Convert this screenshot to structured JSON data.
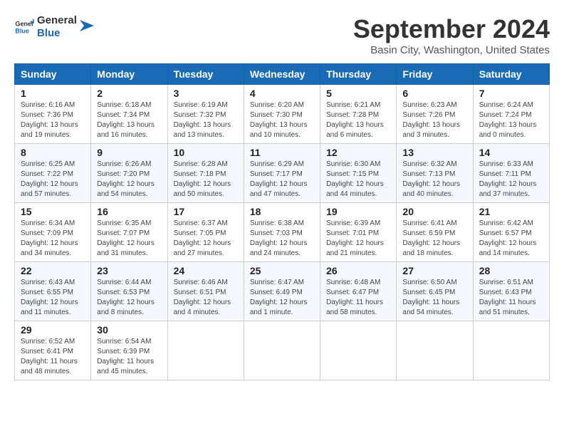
{
  "logo": {
    "line1": "General",
    "line2": "Blue"
  },
  "title": "September 2024",
  "location": "Basin City, Washington, United States",
  "weekdays": [
    "Sunday",
    "Monday",
    "Tuesday",
    "Wednesday",
    "Thursday",
    "Friday",
    "Saturday"
  ],
  "weeks": [
    [
      {
        "day": 1,
        "sunrise": "6:16 AM",
        "sunset": "7:36 PM",
        "daylight": "13 hours and 19 minutes."
      },
      {
        "day": 2,
        "sunrise": "6:18 AM",
        "sunset": "7:34 PM",
        "daylight": "13 hours and 16 minutes."
      },
      {
        "day": 3,
        "sunrise": "6:19 AM",
        "sunset": "7:32 PM",
        "daylight": "13 hours and 13 minutes."
      },
      {
        "day": 4,
        "sunrise": "6:20 AM",
        "sunset": "7:30 PM",
        "daylight": "13 hours and 10 minutes."
      },
      {
        "day": 5,
        "sunrise": "6:21 AM",
        "sunset": "7:28 PM",
        "daylight": "13 hours and 6 minutes."
      },
      {
        "day": 6,
        "sunrise": "6:23 AM",
        "sunset": "7:26 PM",
        "daylight": "13 hours and 3 minutes."
      },
      {
        "day": 7,
        "sunrise": "6:24 AM",
        "sunset": "7:24 PM",
        "daylight": "13 hours and 0 minutes."
      }
    ],
    [
      {
        "day": 8,
        "sunrise": "6:25 AM",
        "sunset": "7:22 PM",
        "daylight": "12 hours and 57 minutes."
      },
      {
        "day": 9,
        "sunrise": "6:26 AM",
        "sunset": "7:20 PM",
        "daylight": "12 hours and 54 minutes."
      },
      {
        "day": 10,
        "sunrise": "6:28 AM",
        "sunset": "7:18 PM",
        "daylight": "12 hours and 50 minutes."
      },
      {
        "day": 11,
        "sunrise": "6:29 AM",
        "sunset": "7:17 PM",
        "daylight": "12 hours and 47 minutes."
      },
      {
        "day": 12,
        "sunrise": "6:30 AM",
        "sunset": "7:15 PM",
        "daylight": "12 hours and 44 minutes."
      },
      {
        "day": 13,
        "sunrise": "6:32 AM",
        "sunset": "7:13 PM",
        "daylight": "12 hours and 40 minutes."
      },
      {
        "day": 14,
        "sunrise": "6:33 AM",
        "sunset": "7:11 PM",
        "daylight": "12 hours and 37 minutes."
      }
    ],
    [
      {
        "day": 15,
        "sunrise": "6:34 AM",
        "sunset": "7:09 PM",
        "daylight": "12 hours and 34 minutes."
      },
      {
        "day": 16,
        "sunrise": "6:35 AM",
        "sunset": "7:07 PM",
        "daylight": "12 hours and 31 minutes."
      },
      {
        "day": 17,
        "sunrise": "6:37 AM",
        "sunset": "7:05 PM",
        "daylight": "12 hours and 27 minutes."
      },
      {
        "day": 18,
        "sunrise": "6:38 AM",
        "sunset": "7:03 PM",
        "daylight": "12 hours and 24 minutes."
      },
      {
        "day": 19,
        "sunrise": "6:39 AM",
        "sunset": "7:01 PM",
        "daylight": "12 hours and 21 minutes."
      },
      {
        "day": 20,
        "sunrise": "6:41 AM",
        "sunset": "6:59 PM",
        "daylight": "12 hours and 18 minutes."
      },
      {
        "day": 21,
        "sunrise": "6:42 AM",
        "sunset": "6:57 PM",
        "daylight": "12 hours and 14 minutes."
      }
    ],
    [
      {
        "day": 22,
        "sunrise": "6:43 AM",
        "sunset": "6:55 PM",
        "daylight": "12 hours and 11 minutes."
      },
      {
        "day": 23,
        "sunrise": "6:44 AM",
        "sunset": "6:53 PM",
        "daylight": "12 hours and 8 minutes."
      },
      {
        "day": 24,
        "sunrise": "6:46 AM",
        "sunset": "6:51 PM",
        "daylight": "12 hours and 4 minutes."
      },
      {
        "day": 25,
        "sunrise": "6:47 AM",
        "sunset": "6:49 PM",
        "daylight": "12 hours and 1 minute."
      },
      {
        "day": 26,
        "sunrise": "6:48 AM",
        "sunset": "6:47 PM",
        "daylight": "11 hours and 58 minutes."
      },
      {
        "day": 27,
        "sunrise": "6:50 AM",
        "sunset": "6:45 PM",
        "daylight": "11 hours and 54 minutes."
      },
      {
        "day": 28,
        "sunrise": "6:51 AM",
        "sunset": "6:43 PM",
        "daylight": "11 hours and 51 minutes."
      }
    ],
    [
      {
        "day": 29,
        "sunrise": "6:52 AM",
        "sunset": "6:41 PM",
        "daylight": "11 hours and 48 minutes."
      },
      {
        "day": 30,
        "sunrise": "6:54 AM",
        "sunset": "6:39 PM",
        "daylight": "11 hours and 45 minutes."
      },
      null,
      null,
      null,
      null,
      null
    ]
  ]
}
